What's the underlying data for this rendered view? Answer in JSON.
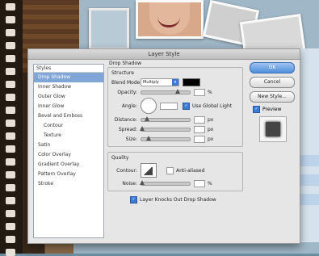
{
  "dialog": {
    "title": "Layer Style"
  },
  "styles_panel": {
    "header": "Styles",
    "items": [
      {
        "label": "Drop Shadow",
        "selected": true,
        "sub": false
      },
      {
        "label": "Inner Shadow",
        "selected": false,
        "sub": false
      },
      {
        "label": "Outer Glow",
        "selected": false,
        "sub": false
      },
      {
        "label": "Inner Glow",
        "selected": false,
        "sub": false
      },
      {
        "label": "Bevel and Emboss",
        "selected": false,
        "sub": false
      },
      {
        "label": "Contour",
        "selected": false,
        "sub": true
      },
      {
        "label": "Texture",
        "selected": false,
        "sub": true
      },
      {
        "label": "Satin",
        "selected": false,
        "sub": false
      },
      {
        "label": "Color Overlay",
        "selected": false,
        "sub": false
      },
      {
        "label": "Gradient Overlay",
        "selected": false,
        "sub": false
      },
      {
        "label": "Pattern Overlay",
        "selected": false,
        "sub": false
      },
      {
        "label": "Stroke",
        "selected": false,
        "sub": false
      }
    ]
  },
  "drop_shadow": {
    "title": "Drop Shadow",
    "structure": {
      "title": "Structure",
      "blend_mode_label": "Blend Mode:",
      "blend_mode_value": "Multiply",
      "opacity_label": "Opacity:",
      "opacity_unit": "%",
      "angle_label": "Angle:",
      "global_light_label": "Use Global Light",
      "distance_label": "Distance:",
      "spread_label": "Spread:",
      "size_label": "Size:",
      "px_unit": "px"
    },
    "quality": {
      "title": "Quality",
      "contour_label": "Contour:",
      "anti_aliased_label": "Anti-aliased",
      "noise_label": "Noise:",
      "noise_unit": "%"
    },
    "knocks_out_label": "Layer Knocks Out Drop Shadow"
  },
  "buttons": {
    "ok": "OK",
    "cancel": "Cancel",
    "new_style": "New Style...",
    "preview": "Preview"
  },
  "colors": {
    "accent": "#3b7bd6",
    "shadow_color": "#000000",
    "selected_row": "#7fa6d6"
  }
}
